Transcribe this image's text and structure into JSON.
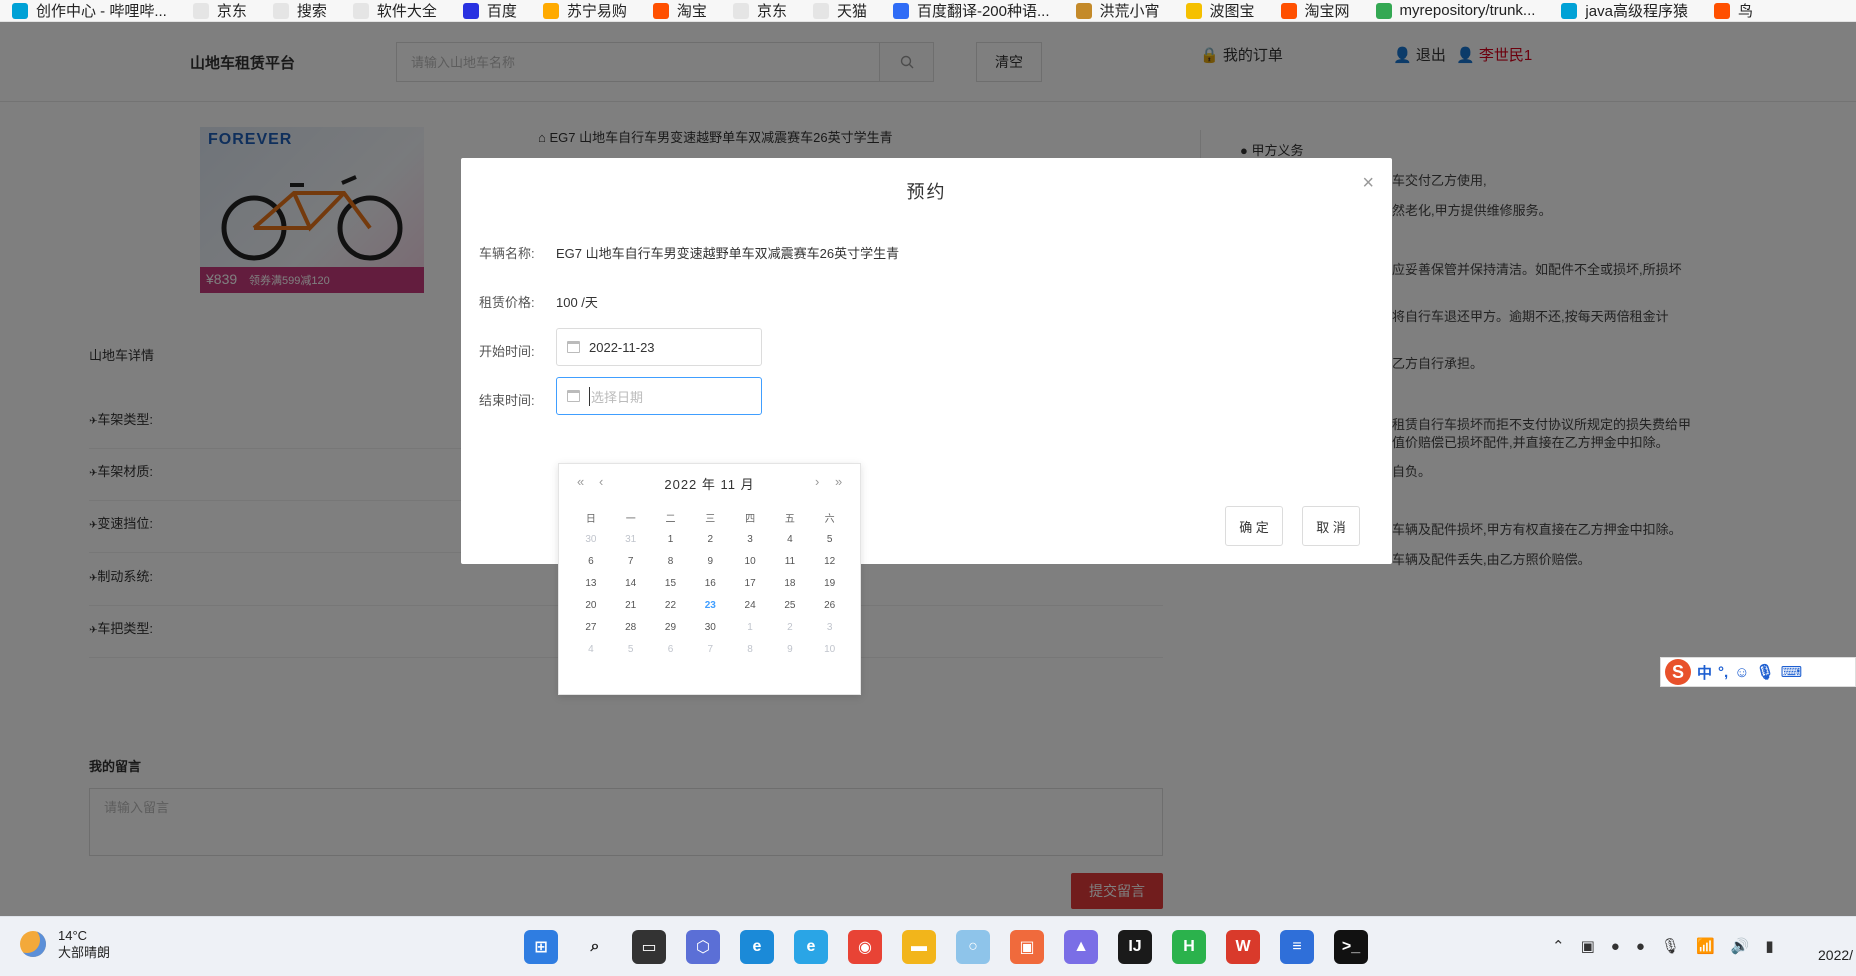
{
  "bookmarks": [
    {
      "label": "创作中心 - 哔哩哔...",
      "color": "#00a1d6"
    },
    {
      "label": "京东",
      "color": "#e5e5e5"
    },
    {
      "label": "搜索",
      "color": "#e5e5e5"
    },
    {
      "label": "软件大全",
      "color": "#e5e5e5"
    },
    {
      "label": "百度",
      "color": "#2932e1"
    },
    {
      "label": "苏宁易购",
      "color": "#ffaa00"
    },
    {
      "label": "淘宝",
      "color": "#ff5000"
    },
    {
      "label": "京东",
      "color": "#e5e5e5"
    },
    {
      "label": "天猫",
      "color": "#e5e5e5"
    },
    {
      "label": "百度翻译-200种语...",
      "color": "#2f6cf6"
    },
    {
      "label": "洪荒小宵",
      "color": "#c48a2a"
    },
    {
      "label": "波图宝",
      "color": "#f5c000"
    },
    {
      "label": "淘宝网",
      "color": "#ff5000"
    },
    {
      "label": "myrepository/trunk...",
      "color": "#34a853"
    },
    {
      "label": "java高级程序猿",
      "color": "#00a1d6"
    },
    {
      "label": "鸟",
      "color": "#ff5000"
    }
  ],
  "header": {
    "brand": "山地车租赁平台",
    "search_placeholder": "请输入山地车名称",
    "search_icon": "search-icon",
    "clear_label": "清空",
    "orders_label": "我的订单",
    "logout_label": "退出",
    "user_name": "李世民1"
  },
  "product": {
    "image_logo": "FOREVER",
    "image_price": "¥839",
    "image_coupon": "领券满599减120",
    "title": "EG7 山地车自行车男变速越野单车双减震赛车26英寸学生青",
    "detail_tab": "山地车详情",
    "specs": [
      "车架类型:",
      "车架材质:",
      "变速挡位:",
      "制动系统:",
      "车把类型:"
    ]
  },
  "obligations": {
    "title": "甲方义务",
    "lines": [
      "车交付乙方使用,",
      "然老化,甲方提供维修服务。",
      "应妥善保管并保持清洁。如配件不全或损坏,所损坏",
      "将自行车退还甲方。逾期不还,按每天两倍租金计",
      "乙方自行承担。",
      "租赁自行车损坏而拒不支付协议所规定的损失费给甲",
      "值价赔偿已损坏配件,并直接在乙方押金中扣除。",
      "自负。",
      "车辆及配件损坏,甲方有权直接在乙方押金中扣除。",
      "车辆及配件丢失,由乙方照价赔偿。"
    ]
  },
  "message": {
    "label": "我的留言",
    "placeholder": "请输入留言",
    "submit_label": "提交留言"
  },
  "modal": {
    "title": "预约",
    "close_icon": "close-icon",
    "vehicle_label": "车辆名称:",
    "vehicle_value": "EG7 山地车自行车男变速越野单车双减震赛车26英寸学生青",
    "price_label": "租赁价格:",
    "price_value": "100 /天",
    "start_label": "开始时间:",
    "start_value": "2022-11-23",
    "end_label": "结束时间:",
    "end_placeholder": "选择日期",
    "confirm_label": "确 定",
    "cancel_label": "取 消"
  },
  "datepicker": {
    "prev_year": "«",
    "prev_month": "‹",
    "next_month": "›",
    "next_year": "»",
    "year_month": "2022 年  11 月",
    "weekdays": [
      "日",
      "一",
      "二",
      "三",
      "四",
      "五",
      "六"
    ],
    "weeks": [
      [
        {
          "d": "30",
          "o": true
        },
        {
          "d": "31",
          "o": true
        },
        {
          "d": "1"
        },
        {
          "d": "2"
        },
        {
          "d": "3"
        },
        {
          "d": "4"
        },
        {
          "d": "5"
        }
      ],
      [
        {
          "d": "6"
        },
        {
          "d": "7"
        },
        {
          "d": "8"
        },
        {
          "d": "9"
        },
        {
          "d": "10"
        },
        {
          "d": "11"
        },
        {
          "d": "12"
        }
      ],
      [
        {
          "d": "13"
        },
        {
          "d": "14"
        },
        {
          "d": "15"
        },
        {
          "d": "16"
        },
        {
          "d": "17"
        },
        {
          "d": "18"
        },
        {
          "d": "19"
        }
      ],
      [
        {
          "d": "20"
        },
        {
          "d": "21"
        },
        {
          "d": "22"
        },
        {
          "d": "23",
          "t": true
        },
        {
          "d": "24"
        },
        {
          "d": "25"
        },
        {
          "d": "26"
        }
      ],
      [
        {
          "d": "27"
        },
        {
          "d": "28"
        },
        {
          "d": "29"
        },
        {
          "d": "30"
        },
        {
          "d": "1",
          "o": true
        },
        {
          "d": "2",
          "o": true
        },
        {
          "d": "3",
          "o": true
        }
      ],
      [
        {
          "d": "4",
          "o": true
        },
        {
          "d": "5",
          "o": true
        },
        {
          "d": "6",
          "o": true
        },
        {
          "d": "7",
          "o": true
        },
        {
          "d": "8",
          "o": true
        },
        {
          "d": "9",
          "o": true
        },
        {
          "d": "10",
          "o": true
        }
      ]
    ]
  },
  "ime": {
    "logo": "S",
    "mode": "中",
    "punct": "°,"
  },
  "taskbar": {
    "temperature": "14°C",
    "weather": "大部晴朗",
    "clock": "2022/"
  }
}
